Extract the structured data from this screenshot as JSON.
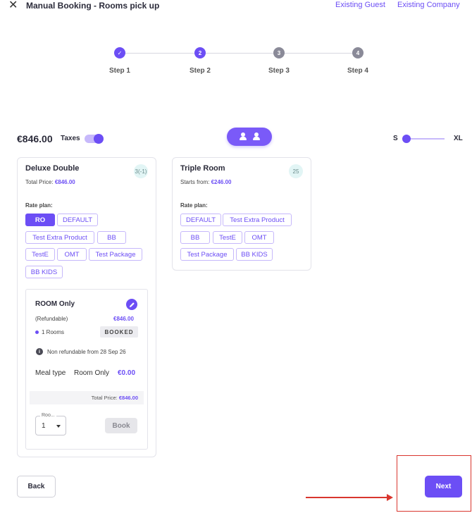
{
  "header": {
    "close_icon": "close-icon",
    "title": "Manual Booking - Rooms pick up",
    "existing_guest": "Existing Guest",
    "existing_company": "Existing Company"
  },
  "stepper": {
    "steps": [
      {
        "number": "✓",
        "label": "Step 1",
        "state": "completed"
      },
      {
        "number": "2",
        "label": "Step 2",
        "state": "active"
      },
      {
        "number": "3",
        "label": "Step 3",
        "state": "inactive"
      },
      {
        "number": "4",
        "label": "Step 4",
        "state": "inactive"
      }
    ]
  },
  "summary": {
    "total": "€846.00",
    "taxes_label": "Taxes",
    "taxes_on": true,
    "size_small": "S",
    "size_large": "XL"
  },
  "rooms": [
    {
      "title": "Deluxe Double",
      "badge": "3(-1)",
      "price_prefix": "Total Price:",
      "price": "€846.00",
      "rate_plan_label": "Rate plan:",
      "chips": [
        "RO",
        "DEFAULT",
        "Test Extra Product",
        "BB",
        "TestE",
        "OMT",
        "Test Package",
        "BB KIDS"
      ],
      "active_chip": "RO"
    },
    {
      "title": "Triple Room",
      "badge": "25",
      "price_prefix": "Starts from:",
      "price": "€246.00",
      "rate_plan_label": "Rate plan:",
      "chips": [
        "DEFAULT",
        "Test Extra Product",
        "BB",
        "TestE",
        "OMT",
        "Test Package",
        "BB KIDS"
      ]
    }
  ],
  "selection": {
    "title": "ROOM Only",
    "refund_text": "(Refundable)",
    "price": "€846.00",
    "rooms_text": "1 Rooms",
    "booked_badge": "BOOKED",
    "notice": "Non refundable from 28 Sep 26",
    "meal_type_label": "Meal type",
    "meal_type_value": "Room Only",
    "meal_price": "€0.00",
    "total_label": "Total Price:",
    "total_value": "€846.00",
    "rooms_select_legend": "Roo...",
    "rooms_select_value": "1",
    "book_label": "Book"
  },
  "footer": {
    "back_label": "Back",
    "next_label": "Next"
  },
  "colors": {
    "accent": "#6c4ef5",
    "annotation": "#d9362e"
  }
}
